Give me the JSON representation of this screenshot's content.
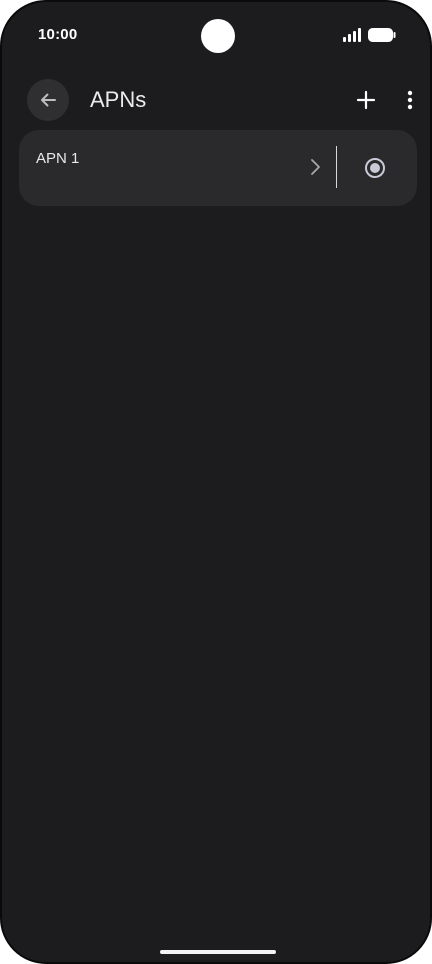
{
  "status_bar": {
    "time": "10:00"
  },
  "top_bar": {
    "title": "APNs",
    "icons": {
      "back": "arrow-back-icon",
      "add": "plus-icon",
      "more": "more-vert-icon"
    }
  },
  "apn_list": {
    "items": [
      {
        "name": "APN 1",
        "selected": true
      }
    ]
  },
  "colors": {
    "background": "#1c1c1e",
    "card": "#2a2a2c",
    "back_button_bg": "#2f2f32",
    "text_primary": "#ececec",
    "radio": "#c9c9d8"
  }
}
